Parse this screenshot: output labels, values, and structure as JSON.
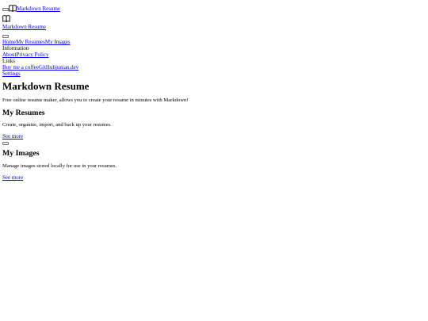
{
  "header": {
    "brand_name": "Markdown Resume",
    "brand_icon": "book-open-icon",
    "menu_icon": "menu-toggle-icon"
  },
  "nav": {
    "primary": [
      {
        "label": "Home"
      },
      {
        "label": "My Resumes"
      },
      {
        "label": "My Images"
      }
    ],
    "information_heading": "Information",
    "information": [
      {
        "label": "About"
      },
      {
        "label": "Privacy Policy"
      }
    ],
    "links_heading": "Links",
    "links": [
      {
        "label": "Buy me a coffee"
      },
      {
        "label": "GitHub"
      },
      {
        "label": "junian.dev"
      }
    ],
    "settings_label": "Settings"
  },
  "main": {
    "title": "Markdown Resume",
    "intro": "Free online resume maker, allows you to create your resume in minutes with Markdown!",
    "sections": [
      {
        "title": "My Resumes",
        "description": "Create, organize, import, and back up your resumes.",
        "link": "See more"
      },
      {
        "title": "My Images",
        "description": "Manage images stored locally for use in your resumes.",
        "link": "See more"
      }
    ]
  },
  "colors": {
    "link": "#0000ee",
    "text": "#000000",
    "background": "#ffffff"
  }
}
